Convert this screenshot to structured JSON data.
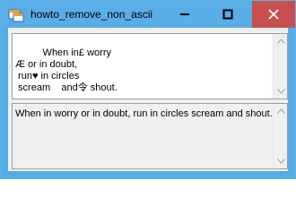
{
  "window": {
    "title": "howto_remove_non_ascii",
    "icon": "app-window-icon"
  },
  "controls": {
    "minimize_icon": "minimize-icon",
    "maximize_icon": "maximize-icon",
    "close_icon": "close-icon",
    "close_color": "#c7504f"
  },
  "input_textbox": {
    "text": "          When in£ worry\nÆ or in doubt,\n run♥ in circles\n scream    and令 shout."
  },
  "output_textbox": {
    "text": "When in worry or in doubt, run in circles scream and shout."
  },
  "colors": {
    "titlebar": "#5aaee8",
    "client": "#f0f0f0"
  }
}
